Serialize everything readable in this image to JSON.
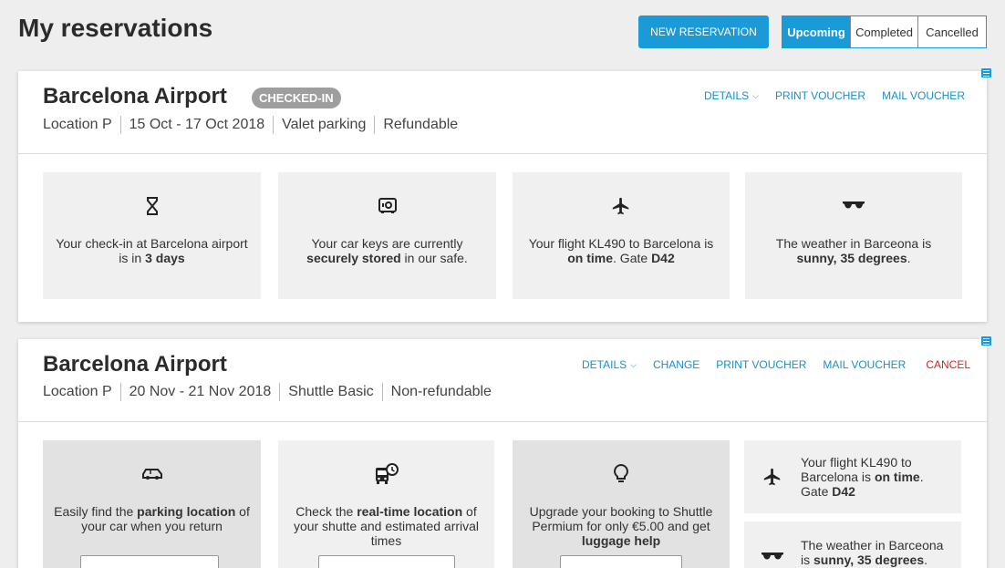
{
  "header": {
    "title": "My reservations",
    "new_button": "NEW RESERVATION",
    "filter": {
      "options": [
        "Upcoming",
        "Completed",
        "Cancelled"
      ],
      "selected": "Upcoming"
    }
  },
  "colors": {
    "accent": "#1a9ad6",
    "cancel": "#e02020",
    "badge": "#9e9e9e"
  },
  "reservations": [
    {
      "title": "Barcelona Airport",
      "badge": "CHECKED-IN",
      "location": "Location P",
      "dates": "15 Oct - 17 Oct 2018",
      "product": "Valet parking",
      "refund": "Refundable",
      "actions": {
        "details": "DETAILS",
        "print": "PRINT VOUCHER",
        "mail": "MAIL VOUCHER"
      },
      "tiles": [
        {
          "icon": "hourglass-icon",
          "pre": "Your check-in at Barcelona airport is in ",
          "bold": "3 days",
          "post": ""
        },
        {
          "icon": "safe-icon",
          "pre": "Your car keys are currently ",
          "bold": "securely stored",
          "post": " in our safe."
        },
        {
          "icon": "airplane-icon",
          "pre": "Your flight KL490 to Barcelona is ",
          "bold": "on time",
          "post": ". Gate ",
          "bold2": "D42"
        },
        {
          "icon": "sunglasses-icon",
          "pre": "The weather in Barceona is ",
          "bold": "sunny, 35 degrees",
          "post": "."
        }
      ]
    },
    {
      "title": "Barcelona Airport",
      "location": "Location P",
      "dates": "20 Nov - 21 Nov 2018",
      "product": "Shuttle Basic",
      "refund": "Non-refundable",
      "actions": {
        "details": "DETAILS",
        "change": "CHANGE",
        "print": "PRINT VOUCHER",
        "mail": "MAIL VOUCHER",
        "cancel": "CANCEL"
      },
      "tiles": [
        {
          "icon": "car-icon",
          "pre": "Easily find the ",
          "bold": "parking location",
          "post": " of your car when you return"
        },
        {
          "icon": "bus-clock-icon",
          "pre": "Check the ",
          "bold": "real-time location",
          "post": " of your shutte and estimated arrival times"
        },
        {
          "icon": "lightbulb-icon",
          "pre": "Upgrade your booking to Shuttle Permium for only €5.00 and get ",
          "bold": "luggage help",
          "post": ""
        }
      ],
      "side": [
        {
          "icon": "airplane-icon",
          "pre": "Your flight KL490 to Barcelona is ",
          "bold": "on time",
          "post": ". Gate ",
          "bold2": "D42"
        },
        {
          "icon": "sunglasses-icon",
          "pre": "The weather in Barceona is ",
          "bold": "sunny, 35 degrees",
          "post": "."
        }
      ]
    }
  ]
}
